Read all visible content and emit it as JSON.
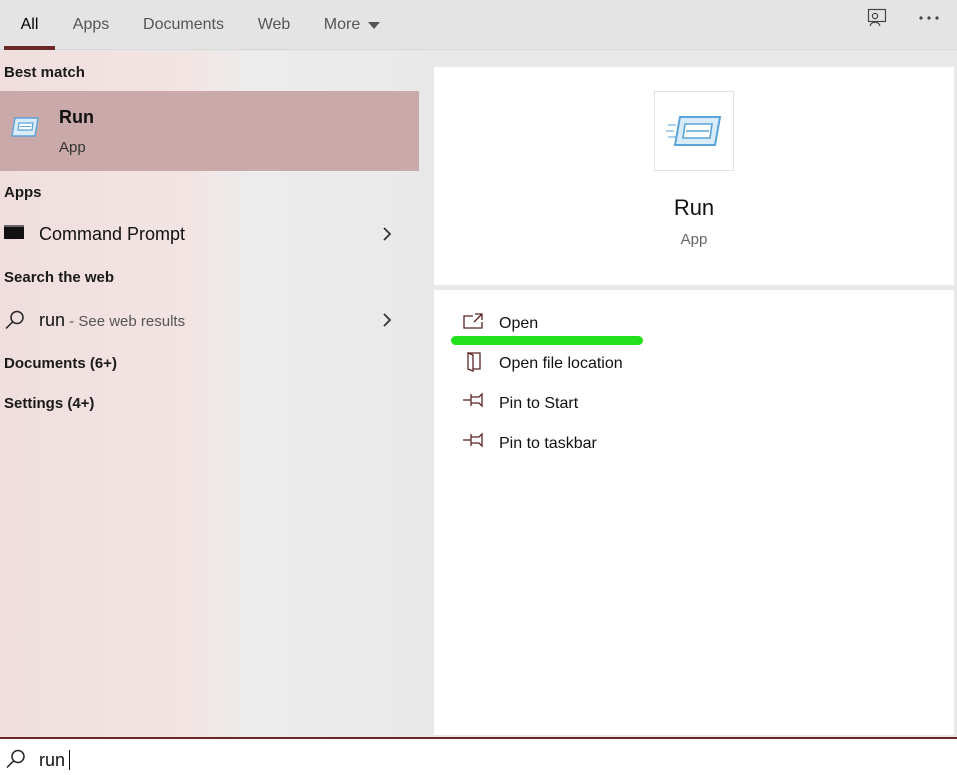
{
  "tabs": [
    {
      "label": "All",
      "active": true
    },
    {
      "label": "Apps",
      "active": false
    },
    {
      "label": "Documents",
      "active": false
    },
    {
      "label": "Web",
      "active": false
    },
    {
      "label": "More",
      "active": false
    }
  ],
  "toolbar_icons": [
    "feedback-icon",
    "more-options-icon"
  ],
  "left": {
    "best_match_header": "Best match",
    "best_match": {
      "title": "Run",
      "subtitle": "App",
      "icon": "run-app-icon"
    },
    "apps_header": "Apps",
    "apps": [
      {
        "label": "Command Prompt",
        "icon": "command-prompt-icon"
      }
    ],
    "web_header": "Search the web",
    "web_result": {
      "query": "run",
      "suffix": " - See web results",
      "icon": "search-icon"
    },
    "documents": "Documents (6+)",
    "settings": "Settings (4+)"
  },
  "right": {
    "app": {
      "title": "Run",
      "subtitle": "App",
      "icon": "run-app-icon"
    },
    "actions": [
      {
        "label": "Open",
        "icon": "open-icon"
      },
      {
        "label": "Open file location",
        "icon": "file-location-icon"
      },
      {
        "label": "Pin to Start",
        "icon": "pin-icon"
      },
      {
        "label": "Pin to taskbar",
        "icon": "pin-icon"
      }
    ]
  },
  "search": {
    "value": "run"
  },
  "colors": {
    "accent": "#6b2626",
    "selection": "#c9a9a9",
    "highlight": "#22e01c"
  }
}
